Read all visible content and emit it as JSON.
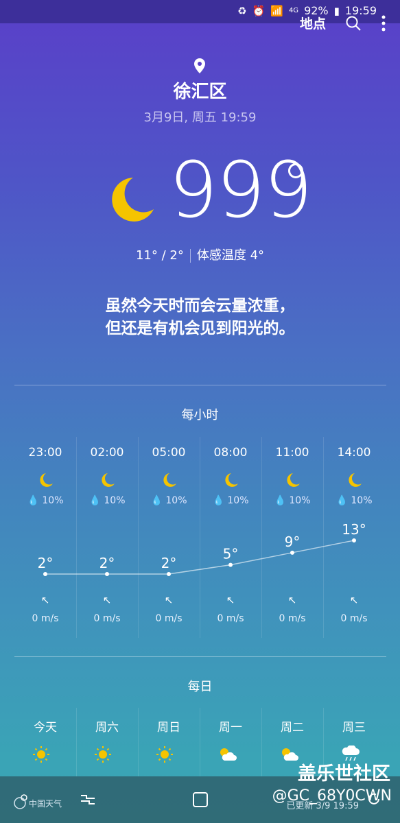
{
  "status_bar": {
    "signal_label": "4G",
    "battery": "92%",
    "time": "19:59"
  },
  "top_bar": {
    "location_button": "地点"
  },
  "location": {
    "district": "徐汇区",
    "datetime": "3月9日, 周五 19:59"
  },
  "current": {
    "temp": "999",
    "hilo": "11° / 2°",
    "feels_like": "体感温度 4°"
  },
  "summary": {
    "line1": "虽然今天时而会云量浓重，",
    "line2": "但还是有机会见到阳光的。"
  },
  "hourly": {
    "title": "每小时",
    "items": [
      {
        "time": "23:00",
        "rain": "10%",
        "temp": "2°",
        "temp_value": 2,
        "wind": "0 m/s"
      },
      {
        "time": "02:00",
        "rain": "10%",
        "temp": "2°",
        "temp_value": 2,
        "wind": "0 m/s"
      },
      {
        "time": "05:00",
        "rain": "10%",
        "temp": "2°",
        "temp_value": 2,
        "wind": "0 m/s"
      },
      {
        "time": "08:00",
        "rain": "10%",
        "temp": "5°",
        "temp_value": 5,
        "wind": "0 m/s"
      },
      {
        "time": "11:00",
        "rain": "10%",
        "temp": "9°",
        "temp_value": 9,
        "wind": "0 m/s"
      },
      {
        "time": "14:00",
        "rain": "10%",
        "temp": "13°",
        "temp_value": 13,
        "wind": "0 m/s"
      }
    ]
  },
  "daily": {
    "title": "每日",
    "items": [
      {
        "day": "今天",
        "icon": "sun-icon"
      },
      {
        "day": "周六",
        "icon": "sun-icon"
      },
      {
        "day": "周日",
        "icon": "sun-icon"
      },
      {
        "day": "周一",
        "icon": "partly-cloudy-icon"
      },
      {
        "day": "周二",
        "icon": "partly-cloudy-icon"
      },
      {
        "day": "周三",
        "icon": "rain-cloud-icon"
      }
    ]
  },
  "footer": {
    "provider": "中国天气",
    "updated": "已更新 3/9 19:59"
  },
  "watermark": {
    "line1": "盖乐世社区",
    "line2": "@GC_68Y0CWN"
  },
  "colors": {
    "moon": "#f5c400",
    "sun": "#f5c400",
    "accent": "#5a3fc9"
  }
}
